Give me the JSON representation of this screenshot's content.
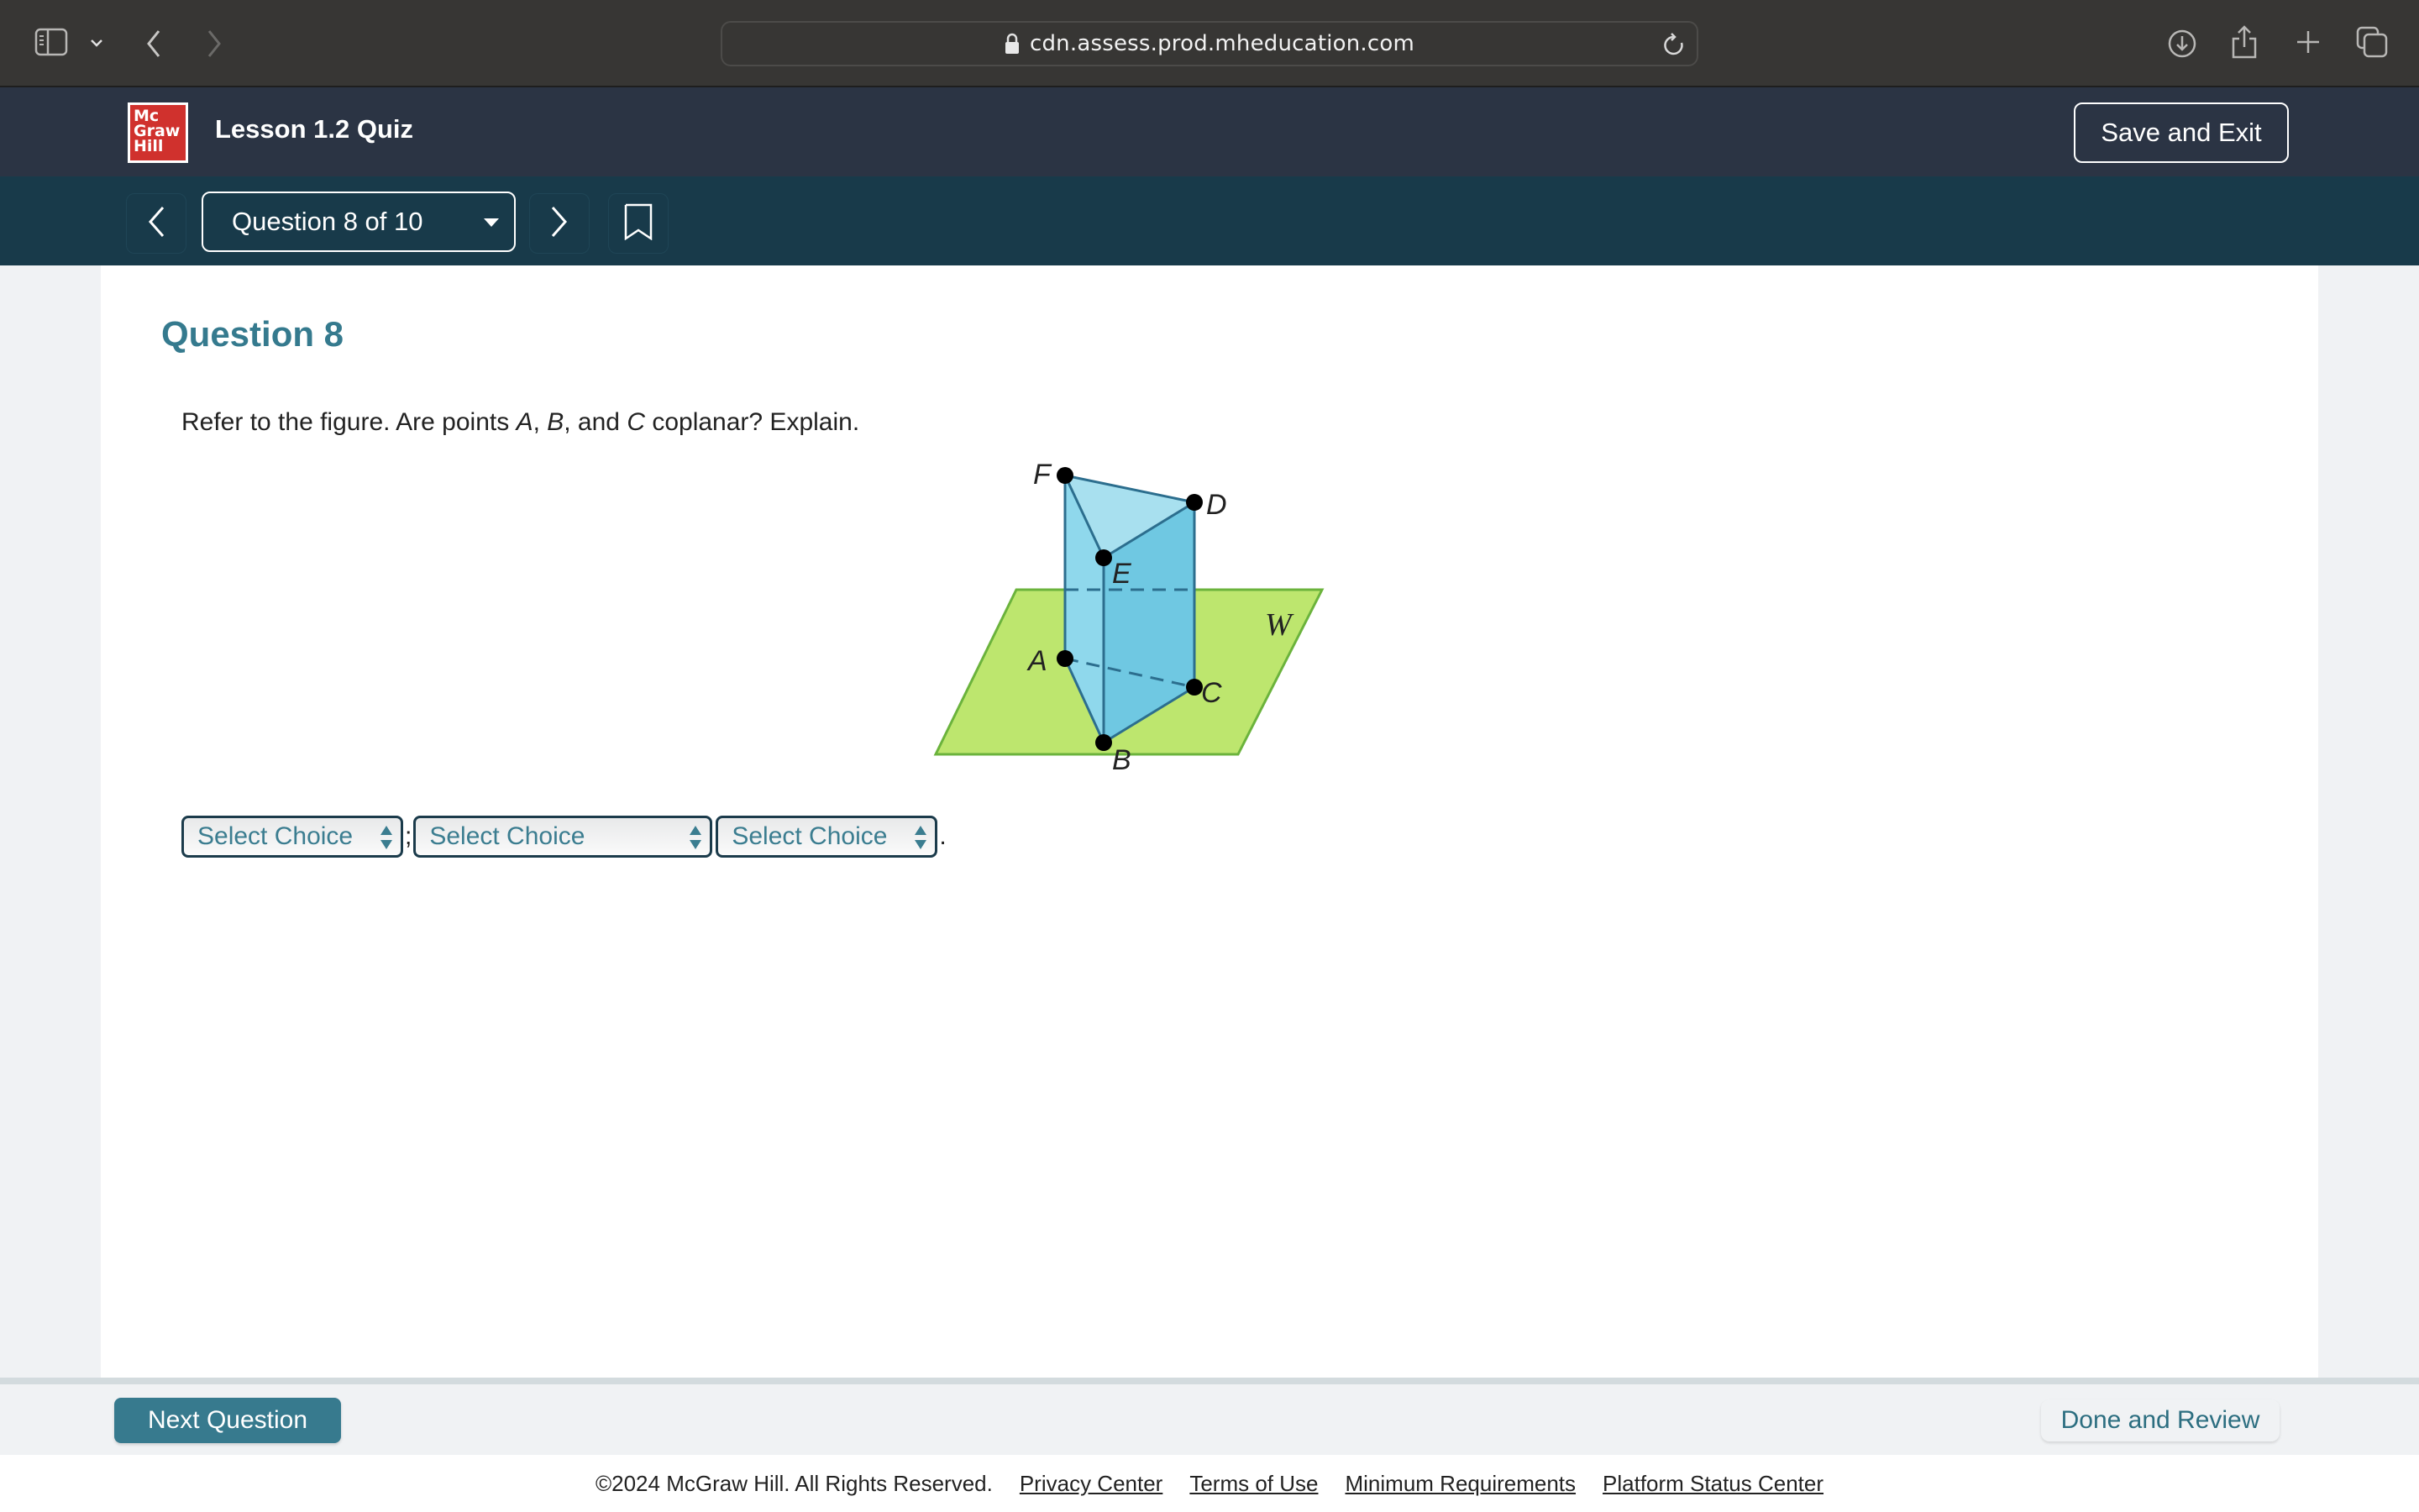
{
  "browser": {
    "url": "cdn.assess.prod.mheducation.com",
    "icons": [
      "sidebar-icon",
      "chevron-down-icon",
      "back-icon",
      "forward-icon",
      "lock-icon",
      "reload-icon",
      "download-icon",
      "share-icon",
      "new-tab-icon",
      "tabs-overview-icon"
    ]
  },
  "header": {
    "logo_lines": [
      "Mc",
      "Graw",
      "Hill"
    ],
    "title": "Lesson 1.2 Quiz",
    "save_exit_label": "Save and Exit"
  },
  "question_nav": {
    "selector_label": "Question 8 of 10",
    "current": 8,
    "total": 10
  },
  "question": {
    "heading": "Question 8",
    "prompt_parts": [
      "Refer to the figure. Are points ",
      "A",
      ", ",
      "B",
      ", and ",
      "C",
      " coplanar? Explain."
    ],
    "figure": {
      "points": [
        "F",
        "D",
        "E",
        "A",
        "C",
        "B"
      ],
      "plane_label": "W",
      "colors": {
        "prism_face": "#7fd0e6",
        "prism_top": "#a8e0ef",
        "prism_edge": "#2c6e8e",
        "plane": "#bde66e",
        "plane_edge": "#6bb33c"
      }
    },
    "answers": [
      {
        "value": "Select Choice",
        "after": ";"
      },
      {
        "value": "Select Choice",
        "after": ""
      },
      {
        "value": "Select Choice",
        "after": "."
      }
    ]
  },
  "footer": {
    "next_label": "Next Question",
    "done_label": "Done and Review",
    "copyright": "©2024 McGraw Hill. All Rights Reserved.",
    "links": [
      "Privacy Center",
      "Terms of Use",
      "Minimum Requirements",
      "Platform Status Center"
    ]
  },
  "colors": {
    "chrome_bg": "#373634",
    "header_bg": "#2b3444",
    "nav_bg": "#183a4a",
    "accent": "#357a8e",
    "logo_red": "#d0312d"
  }
}
